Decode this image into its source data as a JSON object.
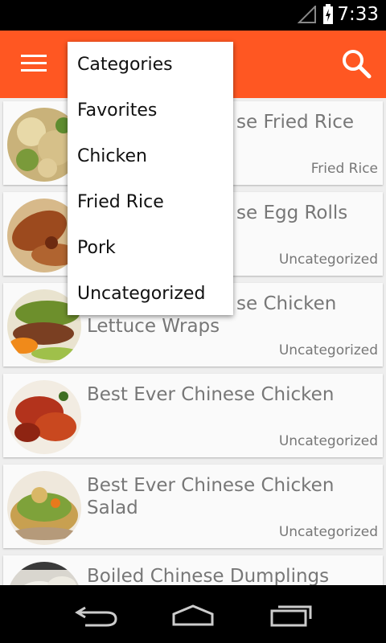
{
  "status": {
    "time": "7:33"
  },
  "appbar": {
    "menu_icon": "hamburger-icon",
    "search_icon": "search-icon",
    "color": "#ff5722"
  },
  "menu": {
    "items": [
      {
        "label": "Categories"
      },
      {
        "label": "Favorites"
      },
      {
        "label": "Chicken"
      },
      {
        "label": "Fried Rice"
      },
      {
        "label": "Pork"
      },
      {
        "label": "Uncategorized"
      }
    ]
  },
  "recipes": [
    {
      "title": "Best Ever Chinese Fried Rice",
      "visible_title": "se Fried Rice",
      "category": "Fried Rice"
    },
    {
      "title": "Best Ever Chinese Egg Rolls",
      "visible_title": "se Egg Rolls",
      "category": "Uncategorized"
    },
    {
      "title": "Best Ever Chinese Chicken Lettuce Wraps",
      "visible_title": "se Chicken",
      "visible_title2": "Lettuce Wraps",
      "category": "Uncategorized"
    },
    {
      "title": "Best Ever Chinese Chicken",
      "category": "Uncategorized"
    },
    {
      "title": "Best Ever Chinese Chicken Salad",
      "category": "Uncategorized"
    },
    {
      "title": "Boiled Chinese Dumplings",
      "category": ""
    }
  ],
  "navbar": {
    "back": "back-icon",
    "home": "home-icon",
    "recents": "recents-icon"
  }
}
